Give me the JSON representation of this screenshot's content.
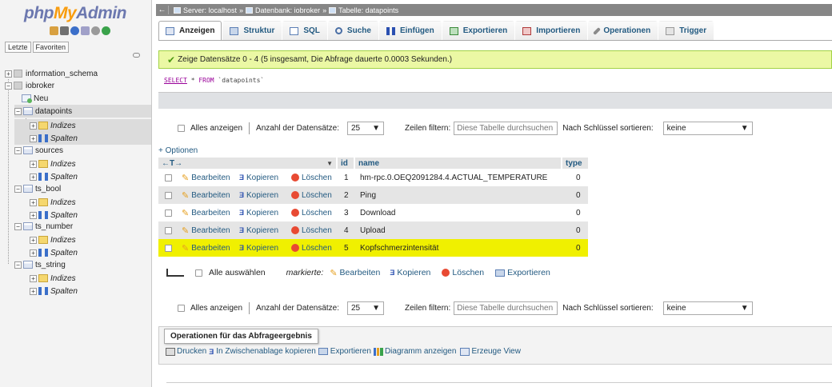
{
  "nav": {
    "logo_php": "php",
    "logo_my": "My",
    "logo_admin": "Admin",
    "tabs": [
      "Letzte",
      "Favoriten"
    ],
    "tree": [
      {
        "label": "information_schema",
        "type": "db"
      },
      {
        "label": "iobroker",
        "type": "db"
      },
      {
        "label": "Neu",
        "type": "new"
      },
      {
        "label": "datapoints",
        "type": "table"
      },
      {
        "label": "Indizes",
        "type": "idx"
      },
      {
        "label": "Spalten",
        "type": "col"
      },
      {
        "label": "sources",
        "type": "table"
      },
      {
        "label": "Indizes",
        "type": "idx"
      },
      {
        "label": "Spalten",
        "type": "col"
      },
      {
        "label": "ts_bool",
        "type": "table"
      },
      {
        "label": "Indizes",
        "type": "idx"
      },
      {
        "label": "Spalten",
        "type": "col"
      },
      {
        "label": "ts_number",
        "type": "table"
      },
      {
        "label": "Indizes",
        "type": "idx"
      },
      {
        "label": "Spalten",
        "type": "col"
      },
      {
        "label": "ts_string",
        "type": "table"
      },
      {
        "label": "Indizes",
        "type": "idx"
      },
      {
        "label": "Spalten",
        "type": "col"
      }
    ]
  },
  "breadcrumb": {
    "back": "←",
    "server": "Server: localhost",
    "db": "Datenbank: iobroker",
    "table": "Tabelle: datapoints",
    "sep": "»"
  },
  "tabs": [
    "Anzeigen",
    "Struktur",
    "SQL",
    "Suche",
    "Einfügen",
    "Exportieren",
    "Importieren",
    "Operationen",
    "Trigger"
  ],
  "success_msg": "Zeige Datensätze 0 - 4 (5 insgesamt, Die Abfrage dauerte 0.0003 Sekunden.)",
  "sql": {
    "select": "SELECT",
    "star": " * ",
    "from": "FROM",
    "table": " `datapoints`"
  },
  "navbar": {
    "show_all": "Alles anzeigen",
    "count_label": "Anzahl der Datensätze:",
    "count_value": "25",
    "filter_label": "Zeilen filtern:",
    "filter_placeholder": "Diese Tabelle durchsuchen",
    "sort_label": "Nach Schlüssel sortieren:",
    "sort_value": "keine"
  },
  "options_link": "+ Optionen",
  "grid": {
    "resize_arrows": "←T→",
    "sort_arrow": "▼",
    "columns": [
      "id",
      "name",
      "type"
    ],
    "actions": {
      "edit": "Bearbeiten",
      "copy": "Kopieren",
      "delete": "Löschen"
    },
    "rows": [
      {
        "id": "1",
        "name": "hm-rpc.0.OEQ2091284.4.ACTUAL_TEMPERATURE",
        "type": "0"
      },
      {
        "id": "2",
        "name": "Ping",
        "type": "0"
      },
      {
        "id": "3",
        "name": "Download",
        "type": "0"
      },
      {
        "id": "4",
        "name": "Upload",
        "type": "0"
      },
      {
        "id": "5",
        "name": "Kopfschmerzintensität",
        "type": "0"
      }
    ]
  },
  "bulk": {
    "select_all": "Alle auswählen",
    "marked": "markierte:",
    "edit": "Bearbeiten",
    "copy": "Kopieren",
    "delete": "Löschen",
    "export": "Exportieren"
  },
  "ops": {
    "legend": "Operationen für das Abfrageergebnis",
    "print": "Drucken",
    "clipboard": "In Zwischenablage kopieren",
    "export": "Exportieren",
    "chart": "Diagramm anzeigen",
    "view": "Erzeuge View"
  },
  "colors": {
    "link": "#235a81",
    "highlight": "#f0f000",
    "success_bg": "#ebf8a4",
    "header_bar": "#868686"
  }
}
